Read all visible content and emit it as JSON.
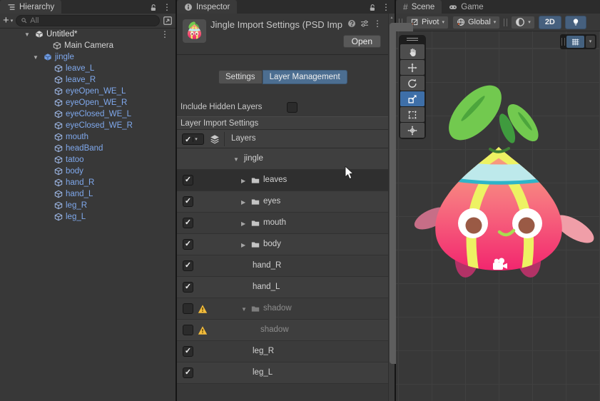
{
  "icons": {
    "kebab": "⋮",
    "caret_down": "▼",
    "caret_right": "▶",
    "caret_down_small": "▾",
    "caret_up_small": "▴",
    "check": "✓",
    "plus": "+",
    "hash": "#"
  },
  "hierarchy": {
    "tab_label": "Hierarchy",
    "search_placeholder": "All",
    "root": {
      "label": "Untitled*"
    },
    "items": [
      {
        "label": "Main Camera"
      },
      {
        "label": "jingle"
      },
      {
        "label": "leave_L"
      },
      {
        "label": "leave_R"
      },
      {
        "label": "eyeOpen_WE_L"
      },
      {
        "label": "eyeOpen_WE_R"
      },
      {
        "label": "eyeClosed_WE_L"
      },
      {
        "label": "eyeClosed_WE_R"
      },
      {
        "label": "mouth"
      },
      {
        "label": "headBand"
      },
      {
        "label": "tatoo"
      },
      {
        "label": "body"
      },
      {
        "label": "hand_R"
      },
      {
        "label": "hand_L"
      },
      {
        "label": "leg_R"
      },
      {
        "label": "leg_L"
      }
    ]
  },
  "inspector": {
    "tab_label": "Inspector",
    "title": "Jingle Import Settings (PSD Imp",
    "open_label": "Open",
    "tab_settings": "Settings",
    "tab_layer_management": "Layer Management",
    "include_hidden_layers_label": "Include Hidden Layers",
    "include_hidden_layers_checked": false,
    "section_title": "Layer Import Settings",
    "column_header": "Layers",
    "layers": [
      {
        "label": "jingle",
        "type": "root",
        "enabled": true,
        "expanded": true
      },
      {
        "label": "leaves",
        "type": "group",
        "enabled": true,
        "expanded": false
      },
      {
        "label": "eyes",
        "type": "group",
        "enabled": true,
        "expanded": false
      },
      {
        "label": "mouth",
        "type": "group",
        "enabled": true,
        "expanded": false
      },
      {
        "label": "body",
        "type": "group",
        "enabled": true,
        "expanded": false
      },
      {
        "label": "hand_R",
        "type": "layer",
        "enabled": true
      },
      {
        "label": "hand_L",
        "type": "layer",
        "enabled": true
      },
      {
        "label": "shadow",
        "type": "group",
        "enabled": false,
        "expanded": true,
        "warning": true
      },
      {
        "label": "shadow",
        "type": "layer",
        "enabled": false,
        "warning": true
      },
      {
        "label": "leg_R",
        "type": "layer",
        "enabled": true
      },
      {
        "label": "leg_L",
        "type": "layer",
        "enabled": true
      }
    ]
  },
  "scene": {
    "tab_scene": "Scene",
    "tab_game": "Game",
    "pivot_label": "Pivot",
    "global_label": "Global",
    "mode_2d_label": "2D"
  },
  "colors": {
    "selected_tab_blue": "#4C6E91",
    "active_tool_blue": "#3E6FA8",
    "prefab_text_blue": "#7FA8EC",
    "warning_yellow": "#F3BC3C",
    "body_gradient_top": "#F7A77E",
    "body_gradient_bottom": "#F2256E",
    "leaf_green": "#72C94F",
    "stripe_yellow": "#EDF263",
    "headband_blue": "#BDE9EB",
    "headband_edge": "#2EB4C8"
  }
}
